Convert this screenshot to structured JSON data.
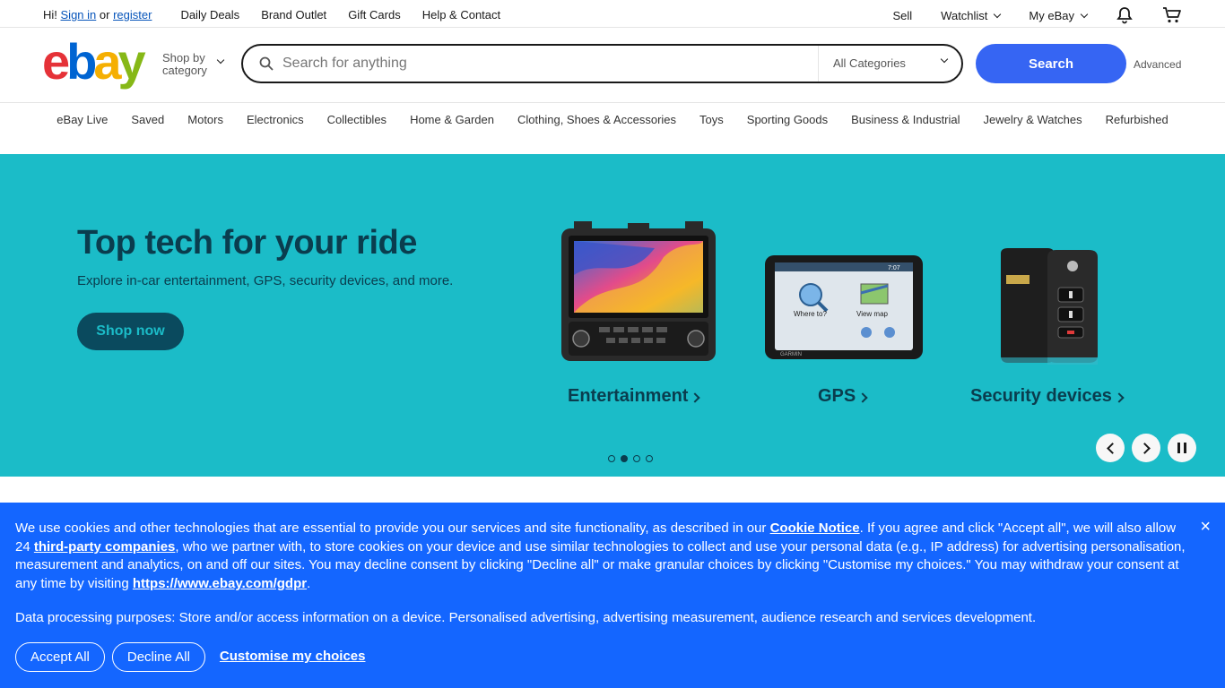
{
  "topbar": {
    "greeting_prefix": "Hi!",
    "sign_in": "Sign in",
    "or": "or",
    "register": "register",
    "links": [
      "Daily Deals",
      "Brand Outlet",
      "Gift Cards",
      "Help & Contact"
    ],
    "sell": "Sell",
    "watchlist": "Watchlist",
    "my_ebay": "My eBay"
  },
  "header": {
    "logo": {
      "e": "e",
      "b": "b",
      "a": "a",
      "y": "y"
    },
    "shop_by_category_line1": "Shop by",
    "shop_by_category_line2": "category",
    "search_placeholder": "Search for anything",
    "category_select": "All Categories",
    "search_button": "Search",
    "advanced": "Advanced"
  },
  "catnav": [
    "eBay Live",
    "Saved",
    "Motors",
    "Electronics",
    "Collectibles",
    "Home & Garden",
    "Clothing, Shoes & Accessories",
    "Toys",
    "Sporting Goods",
    "Business & Industrial",
    "Jewelry & Watches",
    "Refurbished"
  ],
  "hero": {
    "title": "Top tech for your ride",
    "subtitle": "Explore in-car entertainment, GPS, security devices, and more.",
    "cta": "Shop now",
    "tiles": [
      {
        "label": "Entertainment"
      },
      {
        "label": "GPS"
      },
      {
        "label": "Security devices"
      }
    ],
    "gps_screen": {
      "where_to": "Where to?",
      "view_map": "View map",
      "time": "7:07",
      "brand": "GARMIN"
    },
    "active_slide": 2,
    "slide_count": 4
  },
  "cookie": {
    "p1_a": "We use cookies and other technologies that are essential to provide you our services and site functionality, as described in our ",
    "cookie_notice": "Cookie Notice",
    "p1_b": ". If you agree and click \"Accept all\", we will also allow 24 ",
    "third_party": "third-party companies",
    "p1_c": ", who we partner with, to store cookies on your device and use similar technologies to collect and use your personal data (e.g., IP address) for advertising personalisation, measurement and analytics, on and off our sites. You may decline consent by clicking \"Decline all\" or make granular choices by clicking \"Customise my choices.\" You may withdraw your consent at any time by visiting ",
    "gdpr_link": "https://www.ebay.com/gdpr",
    "p1_d": ".",
    "purposes": "Data processing purposes: Store and/or access information on a device. Personalised advertising, advertising measurement, audience research and services development.",
    "accept": "Accept All",
    "decline": "Decline All",
    "customise": "Customise my choices",
    "close": "×"
  },
  "colors": {
    "hero_bg": "#1bbcc8",
    "hero_text": "#0a3d4e",
    "search_button": "#3665f3",
    "cookie_bg": "#1466ff",
    "logo_e": "#e53238",
    "logo_b": "#0064d2",
    "logo_a": "#f5af02",
    "logo_y": "#86b817"
  }
}
